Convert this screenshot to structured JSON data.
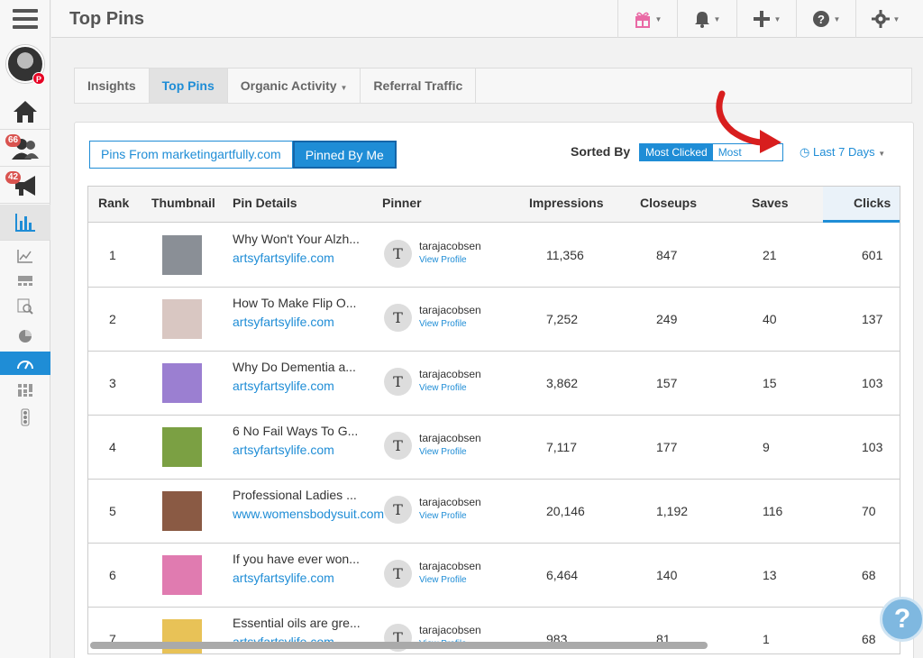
{
  "header": {
    "title": "Top Pins"
  },
  "sidebar": {
    "badges": {
      "followers": "66",
      "campaigns": "42"
    }
  },
  "tabs": [
    {
      "label": "Insights"
    },
    {
      "label": "Top Pins"
    },
    {
      "label": "Organic Activity"
    },
    {
      "label": "Referral Traffic"
    }
  ],
  "filters": {
    "pins_from": "Pins From marketingartfully.com",
    "pinned_by_me": "Pinned By Me",
    "sorted_by_label": "Sorted By",
    "sort_most_clicked": "Most Clicked",
    "sort_most_other": "Most",
    "date_range": "Last 7 Days"
  },
  "table": {
    "headers": {
      "rank": "Rank",
      "thumbnail": "Thumbnail",
      "details": "Pin Details",
      "pinner": "Pinner",
      "impressions": "Impressions",
      "closeups": "Closeups",
      "saves": "Saves",
      "clicks": "Clicks"
    },
    "view_profile_label": "View Profile",
    "rows": [
      {
        "rank": "1",
        "title": "Why Won't Your Alzh...",
        "link": "artsyfartsylife.com",
        "pinner": "tarajacobsen",
        "initial": "T",
        "impressions": "11,356",
        "closeups": "847",
        "saves": "21",
        "clicks": "601",
        "thumb_color": "#8a8f96"
      },
      {
        "rank": "2",
        "title": "How To Make Flip O...",
        "link": "artsyfartsylife.com",
        "pinner": "tarajacobsen",
        "initial": "T",
        "impressions": "7,252",
        "closeups": "249",
        "saves": "40",
        "clicks": "137",
        "thumb_color": "#d9c7c2"
      },
      {
        "rank": "3",
        "title": "Why Do Dementia a...",
        "link": "artsyfartsylife.com",
        "pinner": "tarajacobsen",
        "initial": "T",
        "impressions": "3,862",
        "closeups": "157",
        "saves": "15",
        "clicks": "103",
        "thumb_color": "#9b7fd1"
      },
      {
        "rank": "4",
        "title": "6 No Fail Ways To G...",
        "link": "artsyfartsylife.com",
        "pinner": "tarajacobsen",
        "initial": "T",
        "impressions": "7,117",
        "closeups": "177",
        "saves": "9",
        "clicks": "103",
        "thumb_color": "#7ba043"
      },
      {
        "rank": "5",
        "title": "Professional Ladies ...",
        "link": "www.womensbodysuit.com",
        "pinner": "tarajacobsen",
        "initial": "T",
        "impressions": "20,146",
        "closeups": "1,192",
        "saves": "116",
        "clicks": "70",
        "thumb_color": "#8a5a44"
      },
      {
        "rank": "6",
        "title": "If you have ever won...",
        "link": "artsyfartsylife.com",
        "pinner": "tarajacobsen",
        "initial": "T",
        "impressions": "6,464",
        "closeups": "140",
        "saves": "13",
        "clicks": "68",
        "thumb_color": "#e07bb0"
      },
      {
        "rank": "7",
        "title": "Essential oils are gre...",
        "link": "artsyfartsylife.com",
        "pinner": "tarajacobsen",
        "initial": "T",
        "impressions": "983",
        "closeups": "81",
        "saves": "1",
        "clicks": "68",
        "thumb_color": "#e8c257"
      }
    ]
  },
  "help": {
    "label": "?"
  }
}
